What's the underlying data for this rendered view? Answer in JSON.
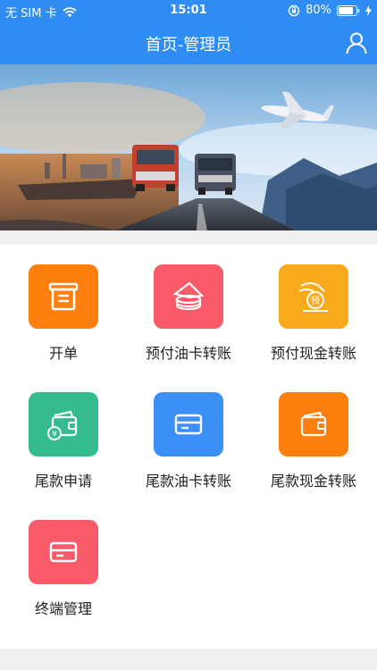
{
  "status": {
    "carrier": "无 SIM 卡",
    "time": "15:01",
    "battery": "80%"
  },
  "nav": {
    "title": "首页-管理员",
    "user_icon": "user-icon"
  },
  "menu": [
    {
      "label": "开单",
      "icon": "document-icon",
      "color": "#ff7f0e"
    },
    {
      "label": "预付油卡转账",
      "icon": "stacked-cards-icon",
      "color": "#f85a67"
    },
    {
      "label": "预付现金转账",
      "icon": "prepay-coin-icon",
      "color": "#f8a91c"
    },
    {
      "label": "尾款申请",
      "icon": "wallet-yuan-icon",
      "color": "#36bb90"
    },
    {
      "label": "尾款油卡转账",
      "icon": "card-icon",
      "color": "#3b8ff5"
    },
    {
      "label": "尾款现金转账",
      "icon": "wallet-icon",
      "color": "#ff7f0e"
    },
    {
      "label": "终端管理",
      "icon": "card-icon",
      "color": "#f85a67"
    }
  ]
}
